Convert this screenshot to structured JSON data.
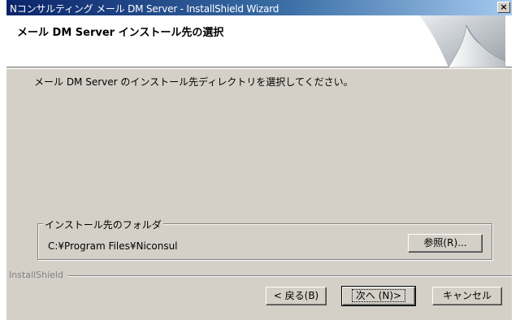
{
  "window": {
    "title": "Nコンサルティング メール DM Server - InstallShield Wizard",
    "close_label": "×"
  },
  "banner": {
    "heading": "メール DM Server インストール先の選択"
  },
  "main": {
    "description": "メール DM Server のインストール先ディレクトリを選択してください。"
  },
  "destination": {
    "legend": "インストール先のフォルダ",
    "path": "C:¥Program Files¥Niconsul",
    "browse_label": "参照(R)..."
  },
  "footer": {
    "brand": "InstallShield",
    "back_label": "< 戻る(B)",
    "next_label": "次へ (N)>",
    "cancel_label": "キャンセル"
  }
}
